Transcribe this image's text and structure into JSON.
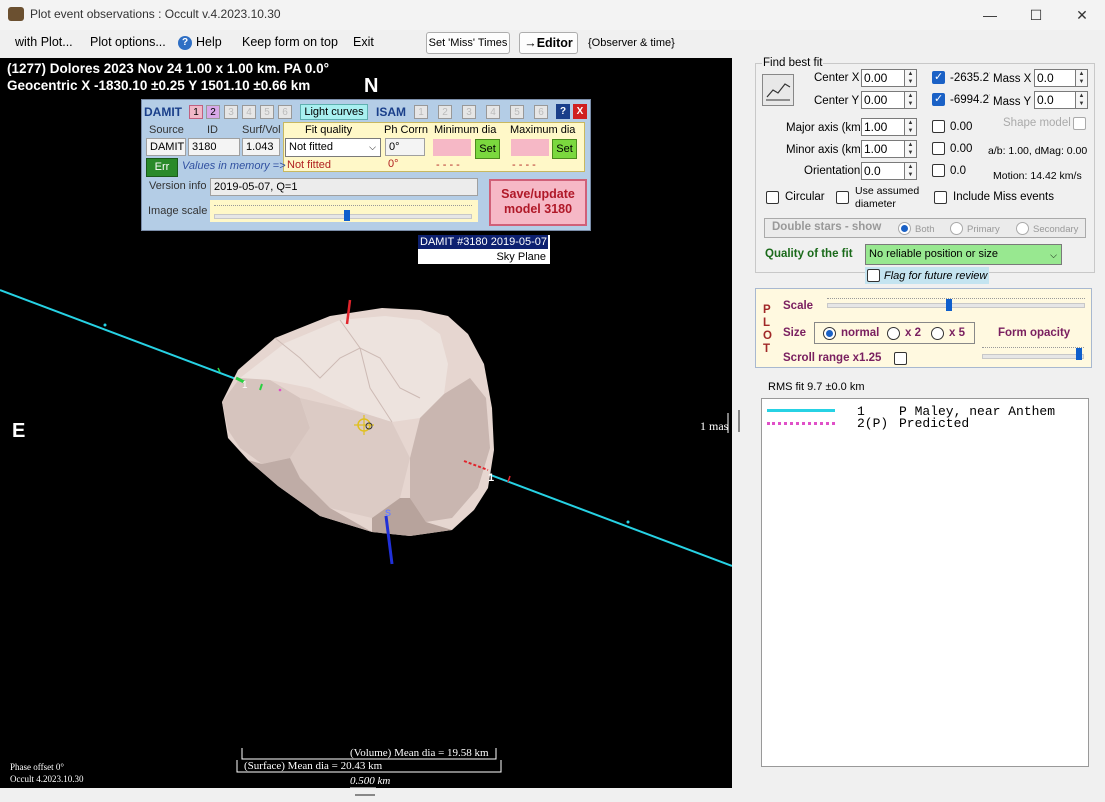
{
  "window": {
    "title": "Plot event observations : Occult v.4.2023.10.30",
    "minimize": "—",
    "maximize": "☐",
    "close": "✕"
  },
  "menu": {
    "with_plot": "with Plot...",
    "plot_options": "Plot options...",
    "help": "Help",
    "keep_on_top": "Keep form on top",
    "exit": "Exit",
    "set_miss_times": "Set 'Miss' Times",
    "editor": "→Editor",
    "observer_time": "{Observer & time}"
  },
  "plot": {
    "header_line1": "(1277) Dolores  2023 Nov 24   1.00 x 1.00 km.  PA 0.0°",
    "header_line2": "Geocentric  X  -1830.10 ±0.25  Y 1501.10 ±0.66 km",
    "north": "N",
    "east": "E",
    "south_marker": "S",
    "chord_label": "1",
    "chord_label_2": "1",
    "scale_mas": "1 mas",
    "damit_caption_1": "DAMIT #3180 2019-05-07",
    "damit_caption_2": "Sky Plane",
    "volume_dia": "(Volume) Mean dia = 19.58 km",
    "surface_dia": "(Surface) Mean dia = 20.43 km",
    "scale_km": "0.500 km",
    "phase_offset": "Phase offset 0°",
    "version": "Occult 4.2023.10.30"
  },
  "damit": {
    "label": "DAMIT",
    "numbers": [
      "1",
      "2",
      "3",
      "4",
      "5",
      "6"
    ],
    "light_curves": "Light curves",
    "isam": "ISAM",
    "isam_numbers": [
      "1",
      "2",
      "3",
      "4",
      "5",
      "6"
    ],
    "help": "?",
    "close": "X",
    "hdr_source": "Source",
    "hdr_id": "ID",
    "hdr_surfvol": "Surf/Vol",
    "source": "DAMIT",
    "id": "3180",
    "surfvol": "1.043",
    "fit_quality_label": "Fit quality",
    "fit_quality_value": "Not fitted",
    "fit_quality_value_2": "Not fitted",
    "ph_corr_label": "Ph Corrn",
    "ph_corr_value": "0°",
    "ph_corr_value_2": "0°",
    "min_dia_label": "Minimum dia",
    "max_dia_label": "Maximum dia",
    "set": "Set",
    "dashes": "- - - -",
    "err": "Err",
    "values_in_memory": "Values in memory =>",
    "version_info_label": "Version info",
    "version_info_value": "2019-05-07, Q=1",
    "image_scale_label": "Image scale",
    "save_update_1": "Save/update",
    "save_update_2": "model 3180"
  },
  "fit": {
    "find_best_fit": "Find best fit",
    "center_x_label": "Center X",
    "center_x": "0.00",
    "center_y_label": "Center Y",
    "center_y": "0.00",
    "val_x": "-2635.27",
    "val_y": "-6994.27",
    "mass_x_label": "Mass X",
    "mass_x": "0.0",
    "mass_y_label": "Mass Y",
    "mass_y": "0.0",
    "major_label": "Major axis (km)",
    "major": "1.00",
    "major_chk": "0.00",
    "minor_label": "Minor axis (km)",
    "minor": "1.00",
    "minor_chk": "0.00",
    "orient_label": "Orientation",
    "orient": "0.0",
    "orient_chk": "0.0",
    "shape_model": "Shape model",
    "ab_dmag": "a/b: 1.00, dMag: 0.00",
    "motion": "Motion: 14.42 km/s",
    "circular": "Circular",
    "assumed_1": "Use assumed",
    "assumed_2": "diameter",
    "include_miss": "Include Miss events",
    "double_stars": "Double stars - show",
    "both": "Both",
    "primary": "Primary",
    "secondary": "Secondary",
    "quality_label": "Quality of the fit",
    "quality_value": "No reliable position or size",
    "flag_review": "Flag for future review"
  },
  "plotpanel": {
    "p": "P",
    "l": "L",
    "o": "O",
    "t": "T",
    "scale": "Scale",
    "size": "Size",
    "normal": "normal",
    "x2": "x 2",
    "x5": "x 5",
    "form_opacity": "Form opacity",
    "scroll_range": "Scroll range x1.25"
  },
  "rms": "RMS fit 9.7 ±0.0 km",
  "legend": [
    {
      "num": "1",
      "name": "P Maley, near Anthem"
    },
    {
      "num": "2(P)",
      "name": "Predicted"
    }
  ],
  "colors": {
    "chord": "#27d2e4",
    "asteroid": "#e8d8d2",
    "predicted": "#e050c8"
  }
}
